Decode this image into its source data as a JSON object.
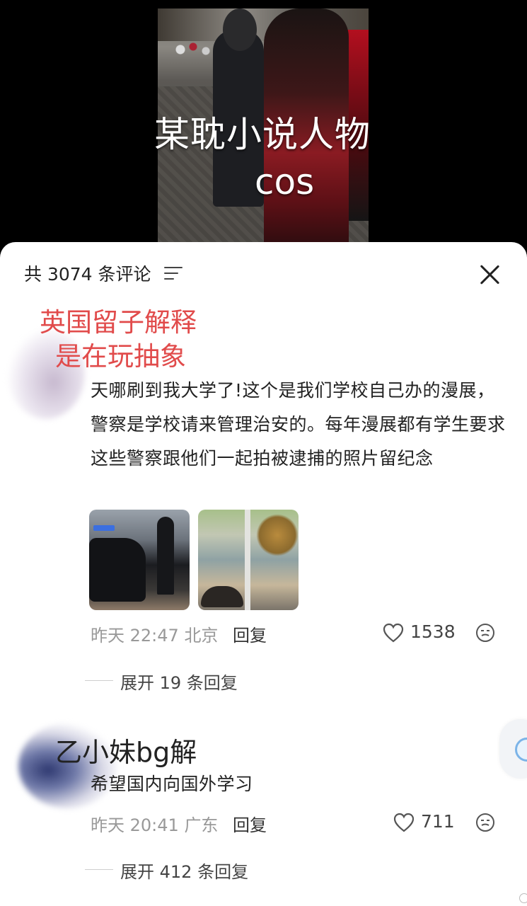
{
  "video": {
    "caption_line1": "某耽小说人物",
    "caption_line2": "cos"
  },
  "header": {
    "comment_count": "共 3074 条评论",
    "filter_icon": "filter-icon",
    "close_icon": "close-icon"
  },
  "annotation": {
    "line1": "英国留子解释",
    "line2": "是在玩抽象",
    "color": "#e14b4b"
  },
  "comments": [
    {
      "text": "天哪刷到我大学了!这个是我们学校自己办的漫展，警察是学校请来管理治安的。每年漫展都有学生要求这些警察跟他们一起拍被逮捕的照片留纪念",
      "time": "昨天 22:47",
      "location": "北京",
      "reply_label": "回复",
      "likes": "1538",
      "expand_label": "展开 19 条回复"
    },
    {
      "username": "乙小妹bg解",
      "text": "希望国内向国外学习",
      "time": "昨天 20:41",
      "location": "广东",
      "reply_label": "回复",
      "likes": "711",
      "expand_label": "展开 412 条回复"
    }
  ]
}
